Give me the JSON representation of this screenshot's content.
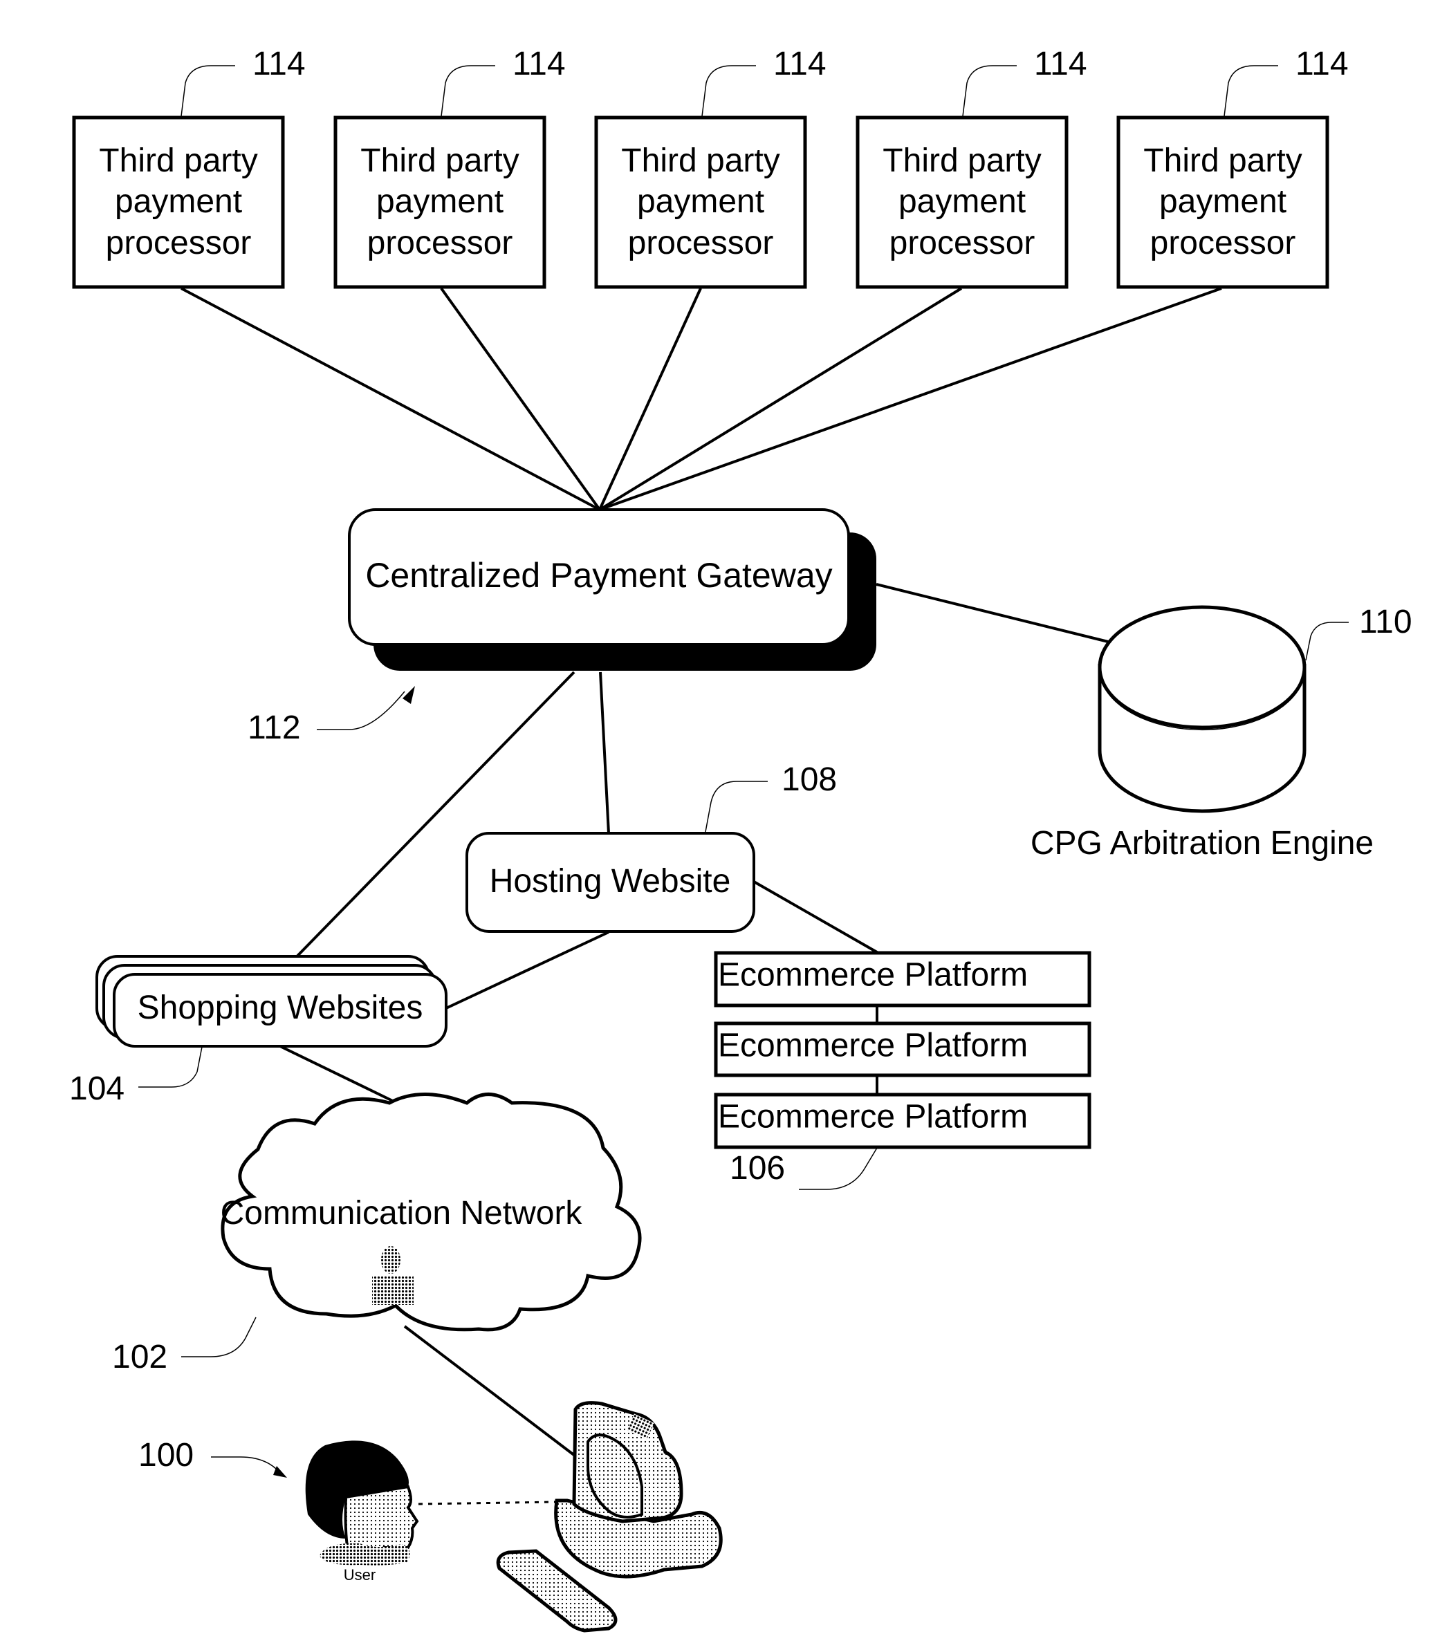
{
  "diagram": {
    "processors": [
      {
        "ref": "114",
        "lines": [
          "Third party",
          "payment",
          "processor"
        ]
      },
      {
        "ref": "114",
        "lines": [
          "Third party",
          "payment",
          "processor"
        ]
      },
      {
        "ref": "114",
        "lines": [
          "Third party",
          "payment",
          "processor"
        ]
      },
      {
        "ref": "114",
        "lines": [
          "Third party",
          "payment",
          "processor"
        ]
      },
      {
        "ref": "114",
        "lines": [
          "Third party",
          "payment",
          "processor"
        ]
      }
    ],
    "gateway": {
      "label": "Centralized Payment Gateway",
      "ref": "112"
    },
    "arbitration_engine": {
      "label": "CPG Arbitration Engine",
      "ref": "110"
    },
    "hosting_website": {
      "label": "Hosting Website",
      "ref": "108"
    },
    "shopping_websites": {
      "label": "Shopping Websites",
      "ref": "104"
    },
    "ecommerce_platforms": {
      "labels": [
        "Ecommerce Platform",
        "Ecommerce Platform",
        "Ecommerce Platform"
      ],
      "ref": "106"
    },
    "network": {
      "label": "Communication Network",
      "ref": "102"
    },
    "user": {
      "label": "User",
      "ref": "100"
    }
  }
}
